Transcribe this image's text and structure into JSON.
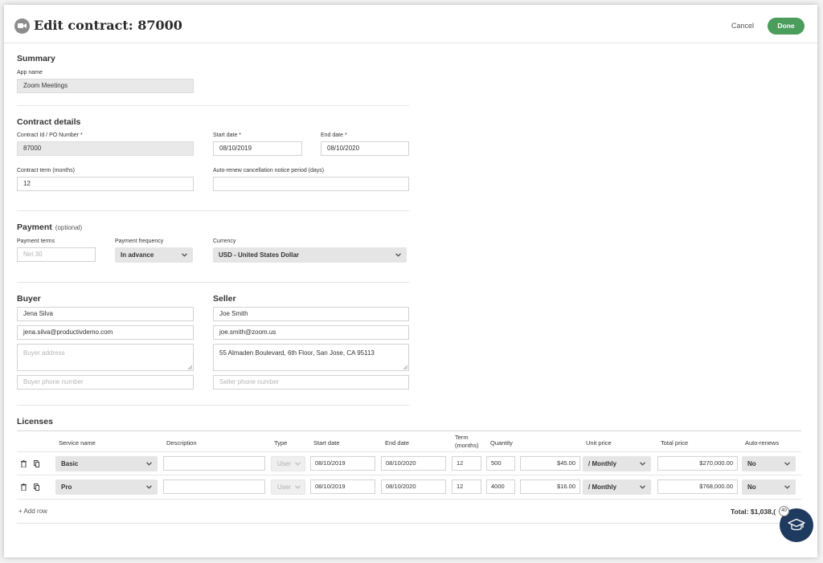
{
  "header": {
    "title": "Edit contract: 87000",
    "cancel_label": "Cancel",
    "done_label": "Done",
    "app_icon": "zoom-camera-icon"
  },
  "summary": {
    "title": "Summary",
    "app_name_label": "App name",
    "app_name_value": "Zoom Meetings"
  },
  "contract": {
    "title": "Contract details",
    "id_label": "Contract Id / PO Number *",
    "id_value": "87000",
    "start_label": "Start date *",
    "start_value": "08/10/2019",
    "end_label": "End date *",
    "end_value": "08/10/2020",
    "term_label": "Contract term (months)",
    "term_value": "12",
    "notice_label": "Auto-renew cancellation notice period (days)",
    "notice_value": ""
  },
  "payment": {
    "title": "Payment",
    "optional": "(optional)",
    "terms_label": "Payment terms",
    "terms_placeholder": "Net 30",
    "frequency_label": "Payment frequency",
    "frequency_value": "In advance",
    "currency_label": "Currency",
    "currency_value": "USD - United States Dollar"
  },
  "buyer": {
    "title": "Buyer",
    "name": "Jena Silva",
    "email": "jena.silva@productivdemo.com",
    "address_placeholder": "Buyer address",
    "phone_placeholder": "Buyer phone number"
  },
  "seller": {
    "title": "Seller",
    "name": "Joe Smith",
    "email": "joe.smith@zoom.us",
    "address": "55 Almaden Boulevard, 6th Floor, San Jose, CA 95113",
    "phone_placeholder": "Seller phone number"
  },
  "licenses": {
    "title": "Licenses",
    "columns": {
      "service": "Service name",
      "description": "Description",
      "type": "Type",
      "start": "Start date",
      "end": "End date",
      "term": "Term (months)",
      "quantity": "Quantity",
      "unit_price": "Unit price",
      "total_price": "Total price",
      "auto_renews": "Auto-renews"
    },
    "rows": [
      {
        "service": "Basic",
        "description": "",
        "type": "User",
        "start": "08/10/2019",
        "end": "08/10/2020",
        "term": "12",
        "quantity": "500",
        "unit_price": "$45.00",
        "period": "/ Monthly",
        "total": "$270,000.00",
        "auto_renews": "No"
      },
      {
        "service": "Pro",
        "description": "",
        "type": "User",
        "start": "08/10/2019",
        "end": "08/10/2020",
        "term": "12",
        "quantity": "4000",
        "unit_price": "$16.00",
        "period": "/ Monthly",
        "total": "$768,000.00",
        "auto_renews": "No"
      }
    ],
    "add_row_label": "+ Add row",
    "total_label": "Total: $1,038,("
  },
  "help": {
    "badge": "40",
    "icon": "graduation-cap-icon"
  }
}
